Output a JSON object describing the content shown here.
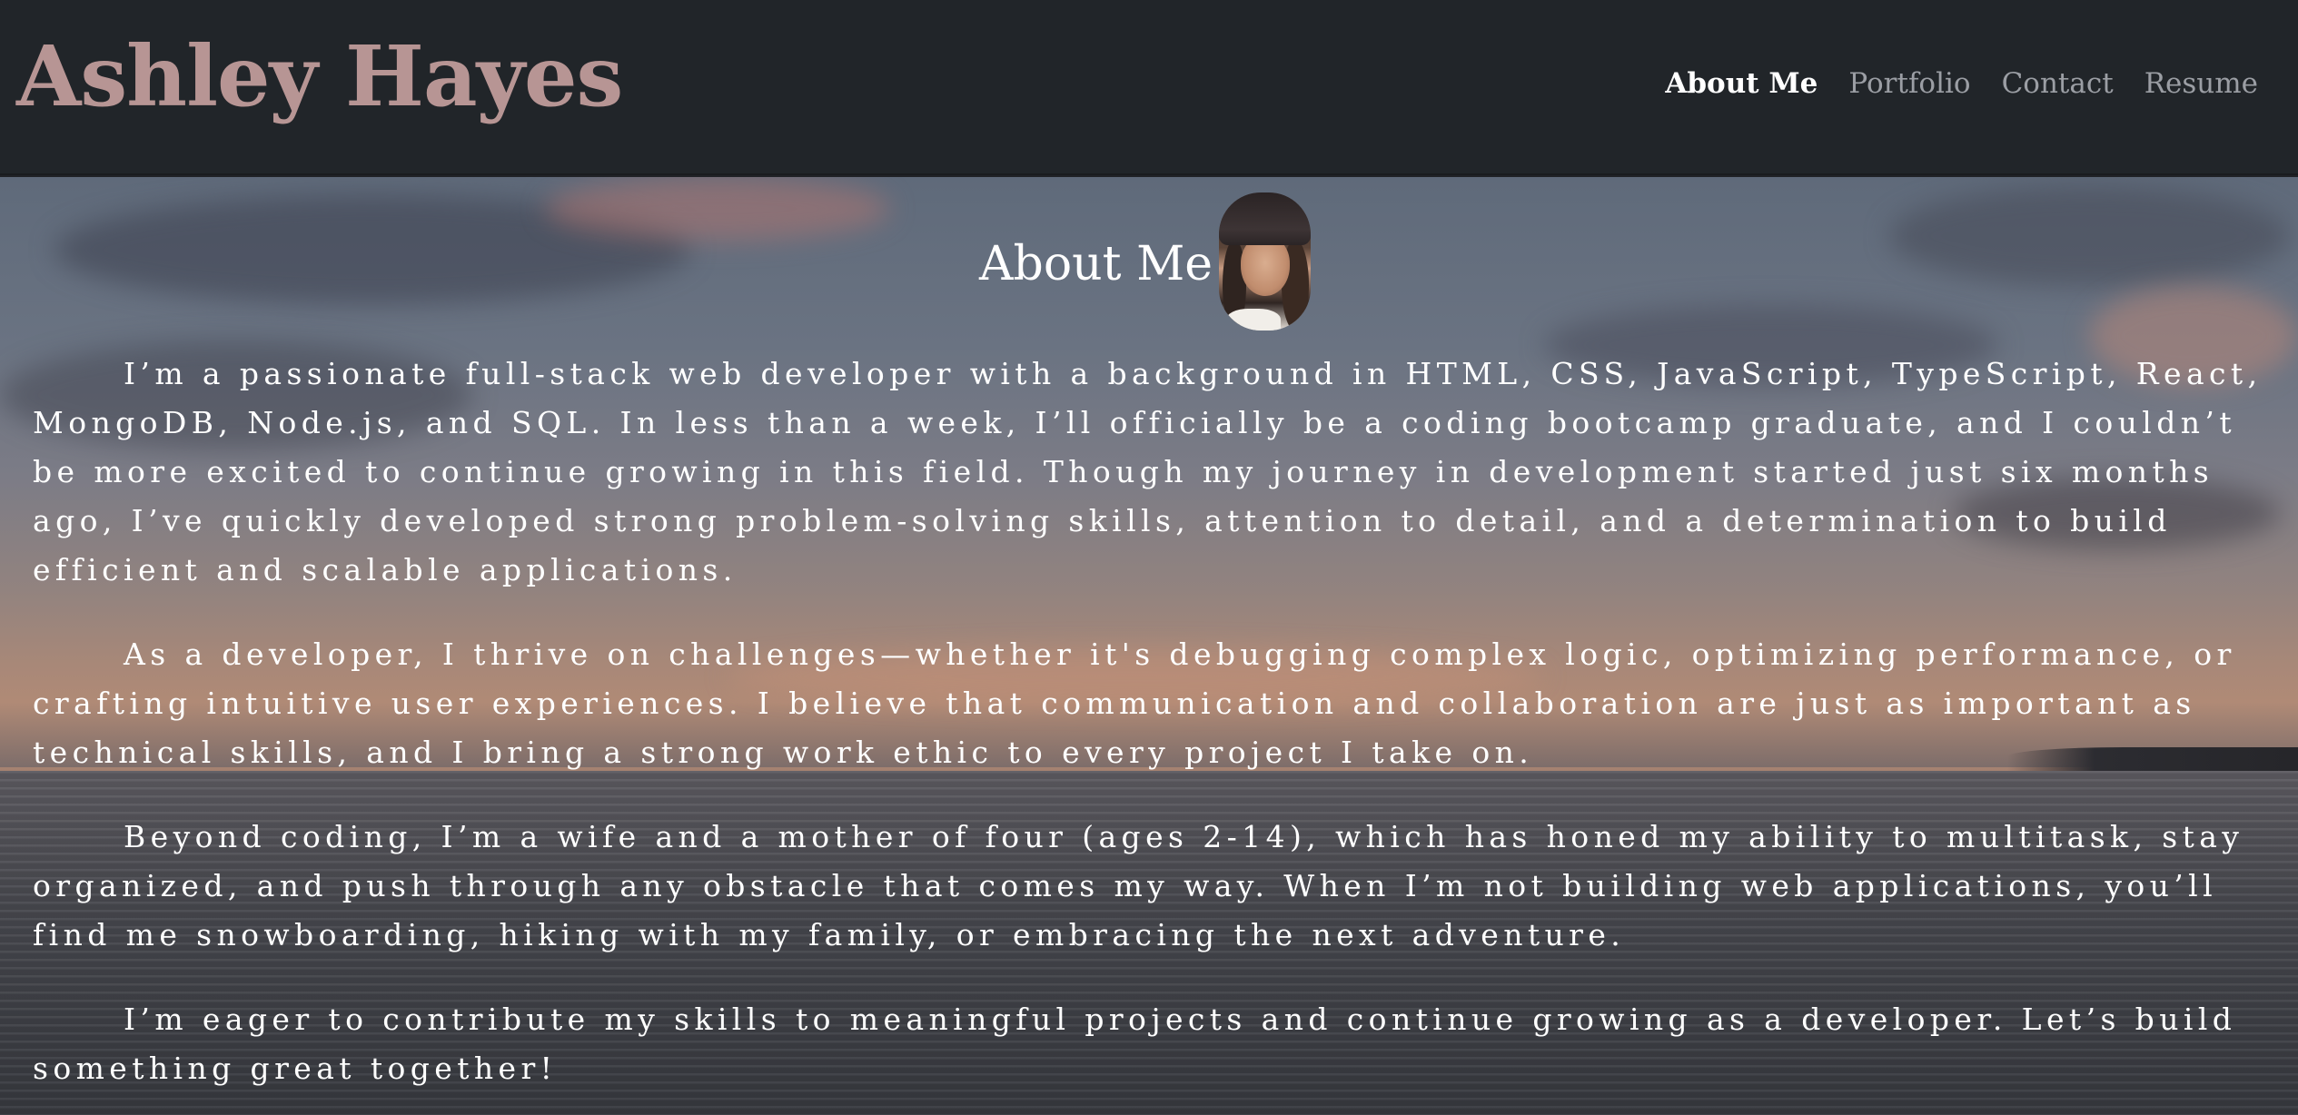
{
  "header": {
    "brand": "Ashley Hayes",
    "nav": [
      {
        "label": "About Me",
        "active": true
      },
      {
        "label": "Portfolio",
        "active": false
      },
      {
        "label": "Contact",
        "active": false
      },
      {
        "label": "Resume",
        "active": false
      }
    ]
  },
  "about": {
    "title": "About Me",
    "paragraphs": [
      "I’m a passionate full-stack web developer with a background in HTML, CSS, JavaScript, TypeScript, React, MongoDB, Node.js, and SQL. In less than a week, I’ll officially be a coding bootcamp graduate, and I couldn’t be more excited to continue growing in this field. Though my journey in development started just six months ago, I’ve quickly developed strong problem-solving skills, attention to detail, and a determination to build efficient and scalable applications.",
      "As a developer, I thrive on challenges—whether it's debugging complex logic, optimizing performance, or crafting intuitive user experiences. I believe that communication and collaboration are just as important as technical skills, and I bring a strong work ethic to every project I take on.",
      "Beyond coding, I’m a wife and a mother of four (ages 2-14), which has honed my ability to multitask, stay organized, and push through any obstacle that comes my way. When I’m not building web applications, you’ll find me snowboarding, hiking with my family, or embracing the next adventure.",
      "I’m eager to contribute my skills to meaningful projects and continue growing as a developer. Let’s build something great together!"
    ]
  },
  "colors": {
    "header_bg": "#212529",
    "brand": "#b79594",
    "nav_active": "#ffffff",
    "nav_inactive": "#9b9ea4",
    "text": "#ffffff"
  }
}
